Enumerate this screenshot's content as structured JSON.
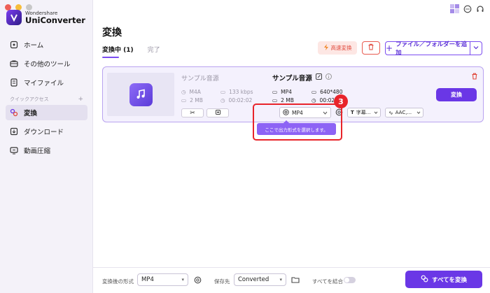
{
  "app": {
    "brand_small": "Wondershare",
    "brand_big": "UniConverter"
  },
  "sidebar": {
    "items": [
      {
        "label": "ホーム",
        "icon": "home-icon"
      },
      {
        "label": "その他のツール",
        "icon": "toolbox-icon"
      },
      {
        "label": "マイファイル",
        "icon": "file-icon"
      }
    ],
    "section_label": "クイックアクセス",
    "section_add": "+",
    "quick": [
      {
        "label": "変換",
        "icon": "convert-icon",
        "active": true
      },
      {
        "label": "ダウンロード",
        "icon": "download-icon"
      },
      {
        "label": "動画圧縮",
        "icon": "compress-icon"
      }
    ]
  },
  "header": {
    "title": "変換",
    "tabs": [
      {
        "label": "変換中 (1)"
      },
      {
        "label": "完了"
      }
    ],
    "high_speed_label": "高速変換",
    "add_files_label": "ファイル／フォルダーを追加"
  },
  "file": {
    "source": {
      "name": "サンプル音源",
      "format": "M4A",
      "bitrate": "133 kbps",
      "size": "2 MB",
      "duration": "00:02:02"
    },
    "output": {
      "name": "サンプル音源",
      "format": "MP4",
      "resolution": "640*480",
      "size": "2 MB",
      "duration": "00:02:02"
    },
    "format_select": "MP4",
    "subtitle_select": "字幕...",
    "audio_select": "AAC,...",
    "convert_label": "変換"
  },
  "callout": {
    "step": "3",
    "tooltip": "ここで出力形式を選択します。"
  },
  "bottom": {
    "output_format_label": "変換後の形式",
    "output_format_value": "MP4",
    "save_to_label": "保存先",
    "save_to_value": "Converted",
    "merge_label": "すべてを結合",
    "convert_all_label": "すべてを変換"
  },
  "colors": {
    "accent": "#6a37e6",
    "danger": "#e8242a"
  }
}
